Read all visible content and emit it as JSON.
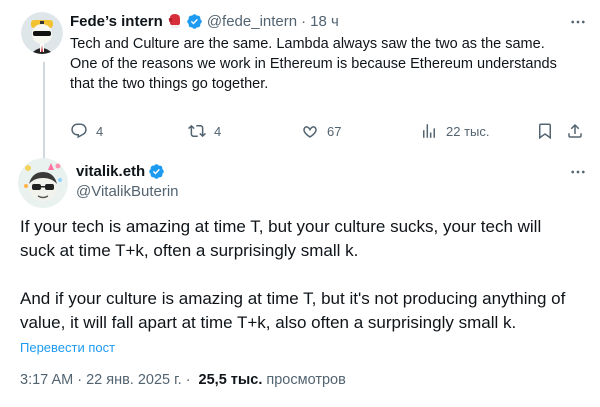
{
  "reply": {
    "name": "Fede’s intern",
    "handle": "@fede_intern",
    "dot": "·",
    "time": "18 ч",
    "text_lines": [
      "Tech and Culture are the same. Lambda always saw the two as the same.",
      "One of the reasons we work in Ethereum is because Ethereum understands",
      "that the two things go together."
    ],
    "stats": {
      "replies": "4",
      "reposts": "4",
      "likes": "67",
      "views": "22 тыс."
    }
  },
  "main": {
    "name": "vitalik.eth",
    "handle": "@VitalikButerin",
    "text_lines_1": [
      "If your tech is amazing at time T, but your culture sucks, your tech will",
      "suck at time T+k, often a surprisingly small k."
    ],
    "text_lines_2": [
      "And if your culture is amazing at time T, but it's not producing anything of",
      "value, it will fall apart at time T+k, also often a surprisingly small k."
    ],
    "translate_label": "Перевести пост",
    "timestamp": "3:17 AM · 22 янв. 2025 г.",
    "dot": "·",
    "views_count": "25,5 тыс.",
    "views_label": "просмотров"
  },
  "colors": {
    "text": "#0f1419",
    "muted": "#536471",
    "accent": "#1d9bf0",
    "verified": "#1d9bf0",
    "line": "#cfd9de"
  },
  "icons": [
    "more-icon",
    "boxing-glove-icon",
    "verified-badge-icon",
    "reply-icon",
    "repost-icon",
    "like-icon",
    "views-icon",
    "bookmark-icon",
    "share-icon"
  ]
}
